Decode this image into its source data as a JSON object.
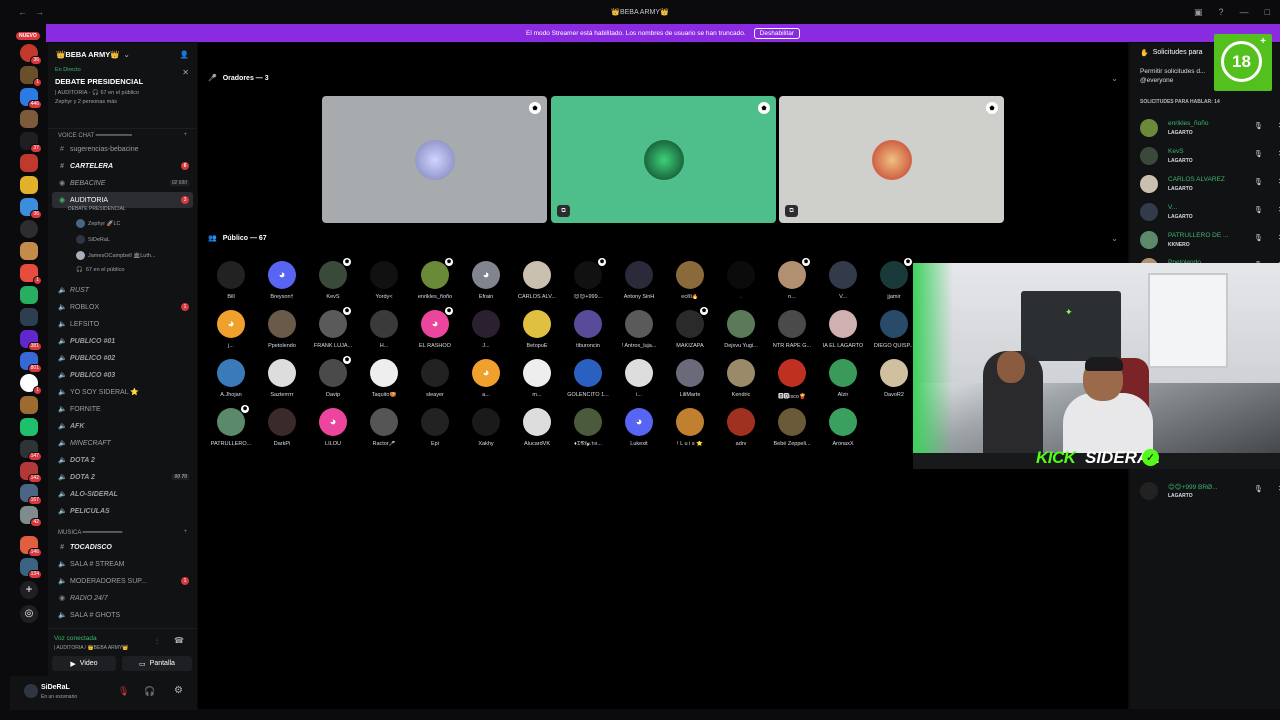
{
  "window": {
    "title": "👑BEBA ARMY👑"
  },
  "banner": {
    "text": "El modo Streamer está habilitado. Los nombres de usuario se han truncado.",
    "button": "Deshabilitar"
  },
  "servers": {
    "new_label": "NUEVO",
    "badges": [
      "36",
      "1",
      "446",
      "37",
      "36",
      "1",
      "381",
      "801",
      "1",
      "147",
      "142",
      "167",
      "42",
      "146",
      "134"
    ]
  },
  "sidebar": {
    "server_name": "👑BEBA ARMY👑",
    "event": {
      "status": "En Directo",
      "title": "DEBATE PRESIDENCIAL",
      "subtitle": "| AUDITORIA · 🎧 67 en el público",
      "people": "Zephyr y 2 personas más"
    },
    "voice_chat_category": "VOICE CHAT ━━━━━━━━━━",
    "music_category": "MUSICA ━━━━━━━━━━━",
    "channels": [
      {
        "name": "sugerencias-bebacine"
      },
      {
        "name": "CARTELERA",
        "badge": "6"
      },
      {
        "name": "BEBACINE",
        "count_a": "02",
        "count_b": "690"
      },
      {
        "name": "AUDITORIA",
        "badge": "3",
        "sub": "DEBATE PRESIDENCIAL"
      },
      {
        "name": "RUST"
      },
      {
        "name": "ROBLOX",
        "badge": "1"
      },
      {
        "name": "LEFSITO"
      },
      {
        "name": "PUBLICO #01"
      },
      {
        "name": "PUBLICO #02"
      },
      {
        "name": "PUBLICO #03"
      },
      {
        "name": "YO SOY SIDERAL ⭐"
      },
      {
        "name": "FORNITE"
      },
      {
        "name": "AFK"
      },
      {
        "name": "MINECRAFT"
      },
      {
        "name": "DOTA 2"
      },
      {
        "name": "DOTA 2",
        "count_a": "00",
        "count_b": "70"
      },
      {
        "name": "ALO-SIDERAL"
      },
      {
        "name": "PELICULAS"
      },
      {
        "name": "TOCADISCO"
      },
      {
        "name": "SALA # STREAM"
      },
      {
        "name": "MODERADORES SUP...",
        "badge": "1"
      },
      {
        "name": "RADIO 24/7"
      },
      {
        "name": "SALA # GHOTS"
      }
    ],
    "auditoria_users": [
      "Zephyr 🚀LC",
      "SiDeRaL",
      "JamesOCampbell 🏛Luth..."
    ],
    "auditoria_public": "67 en el público"
  },
  "voice_panel": {
    "status": "Voz conectada",
    "location": "| AUDITORIA / 👑BEBA ARMY👑",
    "video": "Video",
    "screen": "Pantalla"
  },
  "user": {
    "name": "SiDeRaL",
    "status": "En un escenario"
  },
  "stage": {
    "speakers_header": "Oradores — 3",
    "public_header": "Público — 67",
    "audience": [
      "Bill",
      "Breyson†",
      "KevS",
      "Yordy<",
      "enrikles_ñoño",
      "Efrain",
      "CARLOS ALV...",
      "😊😊+999...",
      "Antony SinH",
      "ecℓℓi🔥",
      ".",
      "n...",
      "V...",
      "jjamir",
      "j...",
      "Ppetolendo",
      "FRANK LUJA...",
      "H...",
      "EL RASHOO",
      "J...",
      "BetopuE",
      "tiburoncin",
      "! Antrox_luja...",
      "MAKIZAPA",
      "Dejxvu Yugi...",
      "NTR RAPE G...",
      "IA EL LAGARTO",
      "DIEGO QUISP...",
      "A.Jhojan",
      "Sazterrrrr",
      "Davip",
      "Taquito🍪",
      "sleayer",
      "a...",
      "m...",
      "GOLENCITO 1...",
      "i...",
      "LiliMarte",
      "Kendric",
      "🅳🅳isco🍟",
      "Alzir",
      "DavoR2",
      "PATRULLERO...",
      "DarkPi",
      "LILOU",
      "Ractor🎤",
      "Epi",
      "Xakhy",
      "AlucardVK",
      "♦𝔇𝔑ℓ𝔂.𝔱𝔪...",
      "Lukexit",
      "! L u i s ⭐",
      "adrv",
      "Bebé Zeppeli...",
      "AronaxX"
    ]
  },
  "requests": {
    "header": "Solicitudes para",
    "permission": "Permitir solicitudes d...",
    "permission_target": "@everyone",
    "list_header": "SOLICITUDES PARA HABLAR: 14",
    "items": [
      {
        "name": "enrikles_ñoño",
        "role": "LAGARTO"
      },
      {
        "name": "KevS",
        "role": "LAGARTO"
      },
      {
        "name": "CARLOS ALVAREZ",
        "role": "LAGARTO"
      },
      {
        "name": "V...",
        "role": "LAGARTO"
      },
      {
        "name": "PATRULLERO DE ...",
        "role": "KKNERO"
      },
      {
        "name": "Ppetolendo",
        "role": ""
      },
      {
        "name": "😊😊+999 BRØ...",
        "role": "LAGARTO"
      }
    ]
  },
  "overlay": {
    "rating": "18",
    "brand": "KICK",
    "channel": "SIDERAL",
    "brand_color": "#53fc18"
  }
}
